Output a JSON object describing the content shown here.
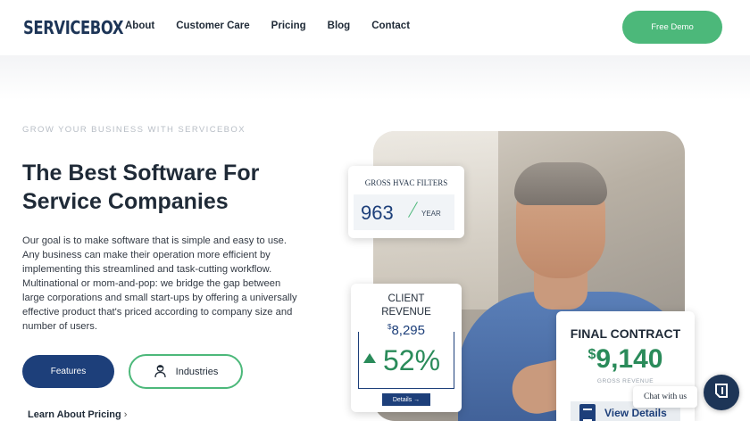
{
  "header": {
    "logo": "SERVICEBOX",
    "nav": [
      "About",
      "Customer Care",
      "Pricing",
      "Blog",
      "Contact"
    ],
    "cta_label": "Free Demo"
  },
  "hero": {
    "eyebrow": "GROW YOUR BUSINESS WITH SERVICEBOX",
    "headline_line1": "The Best Software For",
    "headline_line2": "Service Companies",
    "body": "Our goal is to make software that is simple and easy to use. Any business can make their operation more efficient by implementing this streamlined and task-cutting workflow. Multinational or mom-and-pop: we bridge the gap between large corporations and small start-ups by offering a universally effective product that's priced according to company size and number of users.",
    "features_label": "Features",
    "industries_label": "Industries",
    "learn_label": "Learn About Pricing",
    "learn_chevron": "›"
  },
  "cards": {
    "hvac": {
      "title": "GROSS HVAC FILTERS",
      "value": "963",
      "unit": "YEAR"
    },
    "client": {
      "title_line1": "CLIENT",
      "title_line2": "REVENUE",
      "currency": "$",
      "amount": "8,295",
      "percent": "52%",
      "details_label": "Details →"
    },
    "final": {
      "title": "FINAL CONTRACT",
      "currency": "$",
      "amount": "9,140",
      "subtitle": "GROSS REVENUE",
      "details_label": "View Details"
    }
  },
  "chat": {
    "label": "Chat with us"
  },
  "colors": {
    "brand_navy": "#1d3f7a",
    "accent_green": "#4cb87a",
    "logo_navy": "#1d3557"
  }
}
